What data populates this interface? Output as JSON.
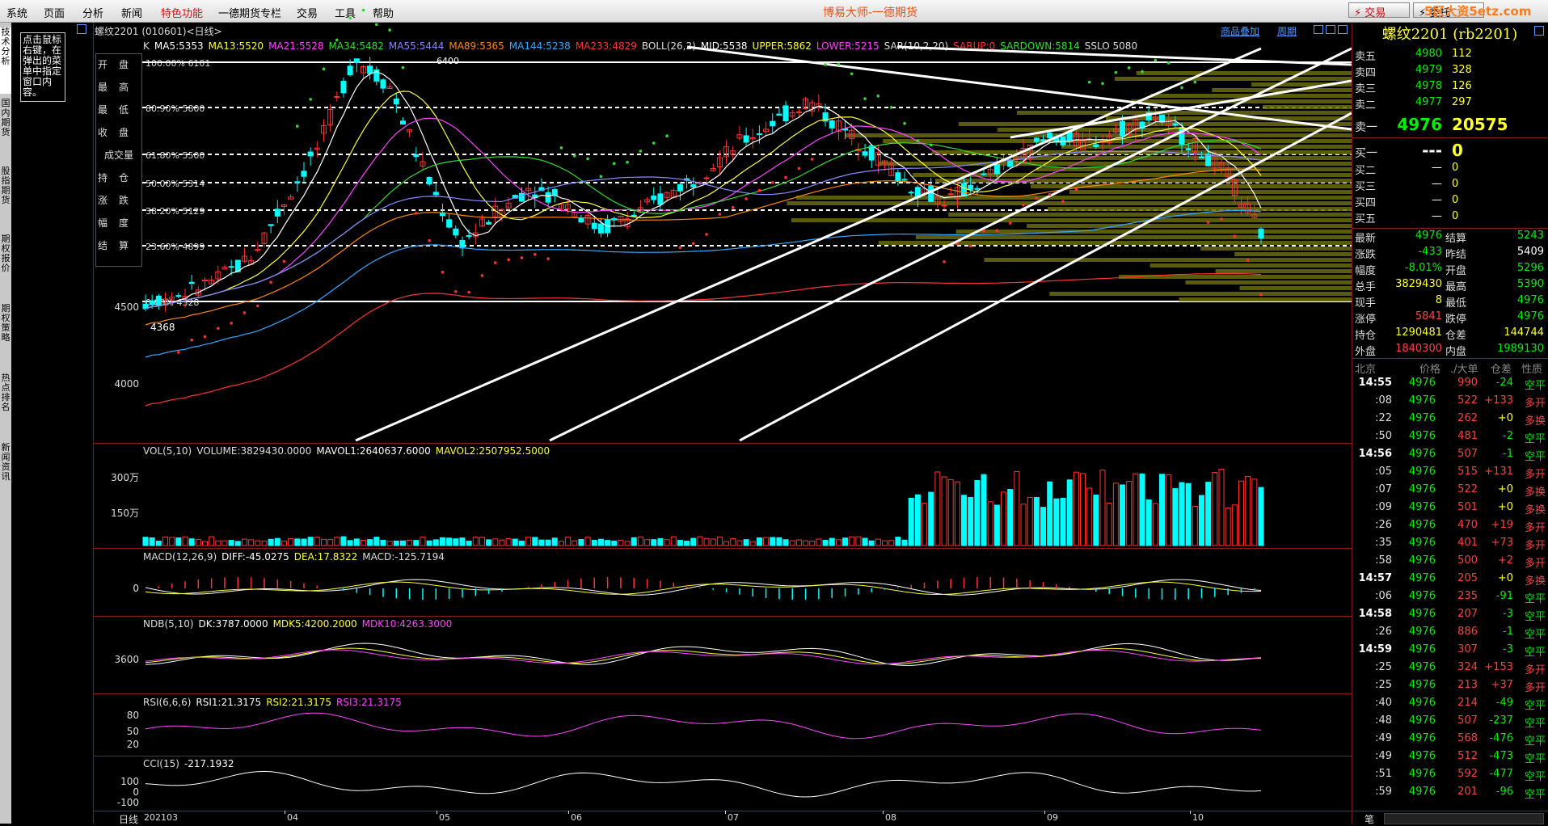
{
  "menu": [
    "系统",
    "页面",
    "分析",
    "新闻",
    "特色功能",
    "一德期货专栏",
    "交易",
    "工具",
    "帮助"
  ],
  "app_title": "博易大师-一德期货",
  "toolbar": {
    "trade_label": "⚡ 交易",
    "second_label": "⚡ 委托",
    "watermark": "5区大资5etz.com"
  },
  "sidebar_tabs": [
    "技术分析",
    "国内期货",
    "股指期货",
    "期权报价",
    "期权策略",
    "热点排名",
    "新闻资讯"
  ],
  "tip_text": "点击鼠标右键，在弹出的菜单中指定窗口内容。",
  "chart_header": {
    "symbol_line": "螺纹2201 (010601)<日线>",
    "overlay_btn": "商品叠加",
    "period_btn": "周期",
    "ma_line": [
      {
        "t": "K",
        "c": "#dddddd"
      },
      {
        "t": "MA5:5353",
        "c": "#ffffff"
      },
      {
        "t": "MA13:5520",
        "c": "#ffff33"
      },
      {
        "t": "MA21:5528",
        "c": "#ff44ff"
      },
      {
        "t": "MA34:5482",
        "c": "#33dd33"
      },
      {
        "t": "MA55:5444",
        "c": "#8888ff"
      },
      {
        "t": "MA89:5365",
        "c": "#ff8800"
      },
      {
        "t": "MA144:5238",
        "c": "#33aaff"
      },
      {
        "t": "MA233:4829",
        "c": "#ff3333"
      },
      {
        "t": "BOLL(26,2)",
        "c": "#dddddd"
      },
      {
        "t": "MID:5538",
        "c": "#ffffff"
      },
      {
        "t": "UPPER:5862",
        "c": "#ffff33"
      },
      {
        "t": "LOWER:5215",
        "c": "#ff44ff"
      },
      {
        "t": "SAR(10,2,20)",
        "c": "#dddddd"
      },
      {
        "t": "SARUP:0",
        "c": "#ff3333"
      },
      {
        "t": "SARDOWN:5814",
        "c": "#33dd33"
      },
      {
        "t": "SSLO 5080",
        "c": "#dddddd"
      }
    ]
  },
  "ohlc_labels": [
    "开盘",
    "最高",
    "最低",
    "收盘",
    "成交量",
    "持仓",
    "涨跌",
    "幅度",
    "结算"
  ],
  "fib_levels": [
    {
      "label": "100.00% 6101",
      "value": 6101
    },
    {
      "label": "80.90% 5800",
      "value": 5800
    },
    {
      "label": "61.80% 5500",
      "value": 5500
    },
    {
      "label": "50.00% 5314",
      "value": 5314
    },
    {
      "label": "38.20% 5129",
      "value": 5129
    },
    {
      "label": "23.60% 4899",
      "value": 4899
    },
    {
      "label": "0.00% 4328",
      "value": 4328
    }
  ],
  "price_annotations": {
    "high": "6400",
    "low": "4368"
  },
  "price_ticks": [
    "4500",
    "4000"
  ],
  "volume_panel": {
    "header": [
      {
        "t": "VOL(5,10)",
        "c": "#dddddd"
      },
      {
        "t": "VOLUME:3829430.0000",
        "c": "#dddddd"
      },
      {
        "t": "MAVOL1:2640637.6000",
        "c": "#ffffff"
      },
      {
        "t": "MAVOL2:2507952.5000",
        "c": "#ffff33"
      }
    ],
    "ticks": [
      "300万",
      "150万"
    ]
  },
  "macd_panel": {
    "header": [
      {
        "t": "MACD(12,26,9)",
        "c": "#dddddd"
      },
      {
        "t": "DIFF:-45.0275",
        "c": "#ffffff"
      },
      {
        "t": "DEA:17.8322",
        "c": "#ffff33"
      },
      {
        "t": "MACD:-125.7194",
        "c": "#dddddd"
      }
    ],
    "ticks": [
      "0"
    ]
  },
  "ndb_panel": {
    "header": [
      {
        "t": "NDB(5,10)",
        "c": "#dddddd"
      },
      {
        "t": "DK:3787.0000",
        "c": "#ffffff"
      },
      {
        "t": "MDK5:4200.2000",
        "c": "#ffff33"
      },
      {
        "t": "MDK10:4263.3000",
        "c": "#ff44ff"
      }
    ],
    "ticks": [
      "3600"
    ]
  },
  "rsi_panel": {
    "header": [
      {
        "t": "RSI(6,6,6)",
        "c": "#dddddd"
      },
      {
        "t": "RSI1:21.3175",
        "c": "#ffffff"
      },
      {
        "t": "RSI2:21.3175",
        "c": "#ffff33"
      },
      {
        "t": "RSI3:21.3175",
        "c": "#ff44ff"
      }
    ],
    "ticks": [
      "80",
      "50",
      "20"
    ]
  },
  "cci_panel": {
    "header": [
      {
        "t": "CCI(15)",
        "c": "#dddddd"
      },
      {
        "t": "-217.1932",
        "c": "#ffffff"
      }
    ],
    "ticks": [
      "100",
      "0",
      "-100"
    ]
  },
  "x_axis": {
    "period": "日线",
    "labels": [
      "202103",
      "04",
      "05",
      "06",
      "07",
      "08",
      "09",
      "10"
    ]
  },
  "right_panel": {
    "title": "螺纹2201 (rb2201)",
    "asks": [
      {
        "label": "卖五",
        "price": "4980",
        "vol": "112"
      },
      {
        "label": "卖四",
        "price": "4979",
        "vol": "328"
      },
      {
        "label": "卖三",
        "price": "4978",
        "vol": "126"
      },
      {
        "label": "卖二",
        "price": "4977",
        "vol": "297"
      },
      {
        "label": "卖一",
        "price": "4976",
        "vol": "20575"
      }
    ],
    "bids": [
      {
        "label": "买一",
        "price": "---",
        "vol": "0"
      },
      {
        "label": "买二",
        "price": "—",
        "vol": "0"
      },
      {
        "label": "买三",
        "price": "—",
        "vol": "0"
      },
      {
        "label": "买四",
        "price": "—",
        "vol": "0"
      },
      {
        "label": "买五",
        "price": "—",
        "vol": "0"
      }
    ],
    "stats": [
      {
        "l1": "最新",
        "v1": "4976",
        "c1": "green",
        "l2": "结算",
        "v2": "5243",
        "c2": "green"
      },
      {
        "l1": "涨跌",
        "v1": "-433",
        "c1": "green",
        "l2": "昨结",
        "v2": "5409",
        "c2": "white"
      },
      {
        "l1": "幅度",
        "v1": "-8.01%",
        "c1": "green",
        "l2": "开盘",
        "v2": "5296",
        "c2": "green"
      },
      {
        "l1": "总手",
        "v1": "3829430",
        "c1": "yellow",
        "l2": "最高",
        "v2": "5390",
        "c2": "green"
      },
      {
        "l1": "现手",
        "v1": "8",
        "c1": "yellow",
        "l2": "最低",
        "v2": "4976",
        "c2": "green"
      },
      {
        "l1": "涨停",
        "v1": "5841",
        "c1": "red",
        "l2": "跌停",
        "v2": "4976",
        "c2": "green"
      },
      {
        "l1": "持仓",
        "v1": "1290481",
        "c1": "yellow",
        "l2": "仓差",
        "v2": "144744",
        "c2": "yellow"
      },
      {
        "l1": "外盘",
        "v1": "1840300",
        "c1": "red",
        "l2": "内盘",
        "v2": "1989130",
        "c2": "green"
      }
    ],
    "ticks_header": {
      "loc": "北京",
      "price": "价格",
      "big": "./大单",
      "oi": "仓差",
      "nature": "性质"
    },
    "ticks": [
      {
        "time": "14:55",
        "price": "4976",
        "vol": "990",
        "oi": "-24",
        "nat": "空平",
        "oc": "green",
        "nc": "green"
      },
      {
        "time": ":08",
        "price": "4976",
        "vol": "522",
        "oi": "+133",
        "nat": "多开",
        "oc": "red",
        "nc": "red"
      },
      {
        "time": ":22",
        "price": "4976",
        "vol": "262",
        "oi": "+0",
        "nat": "多换",
        "oc": "yellow",
        "nc": "red"
      },
      {
        "time": ":50",
        "price": "4976",
        "vol": "481",
        "oi": "-2",
        "nat": "空平",
        "oc": "green",
        "nc": "green"
      },
      {
        "time": "14:56",
        "price": "4976",
        "vol": "507",
        "oi": "-1",
        "nat": "空平",
        "oc": "green",
        "nc": "green"
      },
      {
        "time": ":05",
        "price": "4976",
        "vol": "515",
        "oi": "+131",
        "nat": "多开",
        "oc": "red",
        "nc": "red"
      },
      {
        "time": ":07",
        "price": "4976",
        "vol": "522",
        "oi": "+0",
        "nat": "多换",
        "oc": "yellow",
        "nc": "red"
      },
      {
        "time": ":09",
        "price": "4976",
        "vol": "501",
        "oi": "+0",
        "nat": "多换",
        "oc": "yellow",
        "nc": "red"
      },
      {
        "time": ":26",
        "price": "4976",
        "vol": "470",
        "oi": "+19",
        "nat": "多开",
        "oc": "red",
        "nc": "red"
      },
      {
        "time": ":35",
        "price": "4976",
        "vol": "401",
        "oi": "+73",
        "nat": "多开",
        "oc": "red",
        "nc": "red"
      },
      {
        "time": ":58",
        "price": "4976",
        "vol": "500",
        "oi": "+2",
        "nat": "多开",
        "oc": "red",
        "nc": "red"
      },
      {
        "time": "14:57",
        "price": "4976",
        "vol": "205",
        "oi": "+0",
        "nat": "多换",
        "oc": "yellow",
        "nc": "red"
      },
      {
        "time": ":06",
        "price": "4976",
        "vol": "235",
        "oi": "-91",
        "nat": "空平",
        "oc": "green",
        "nc": "green"
      },
      {
        "time": "14:58",
        "price": "4976",
        "vol": "207",
        "oi": "-3",
        "nat": "空平",
        "oc": "green",
        "nc": "green"
      },
      {
        "time": ":26",
        "price": "4976",
        "vol": "886",
        "oi": "-1",
        "nat": "空平",
        "oc": "green",
        "nc": "green"
      },
      {
        "time": "14:59",
        "price": "4976",
        "vol": "307",
        "oi": "-3",
        "nat": "空平",
        "oc": "green",
        "nc": "green"
      },
      {
        "time": ":25",
        "price": "4976",
        "vol": "324",
        "oi": "+153",
        "nat": "多开",
        "oc": "red",
        "nc": "red"
      },
      {
        "time": ":25",
        "price": "4976",
        "vol": "213",
        "oi": "+37",
        "nat": "多开",
        "oc": "red",
        "nc": "red"
      },
      {
        "time": ":40",
        "price": "4976",
        "vol": "214",
        "oi": "-49",
        "nat": "空平",
        "oc": "green",
        "nc": "green"
      },
      {
        "time": ":48",
        "price": "4976",
        "vol": "507",
        "oi": "-237",
        "nat": "空平",
        "oc": "green",
        "nc": "green"
      },
      {
        "time": ":49",
        "price": "4976",
        "vol": "568",
        "oi": "-476",
        "nat": "空平",
        "oc": "green",
        "nc": "green"
      },
      {
        "time": ":49",
        "price": "4976",
        "vol": "512",
        "oi": "-473",
        "nat": "空平",
        "oc": "green",
        "nc": "green"
      },
      {
        "time": ":51",
        "price": "4976",
        "vol": "592",
        "oi": "-477",
        "nat": "空平",
        "oc": "green",
        "nc": "green"
      },
      {
        "time": ":59",
        "price": "4976",
        "vol": "201",
        "oi": "-96",
        "nat": "空平",
        "oc": "green",
        "nc": "green"
      }
    ],
    "footer_label": "笔"
  }
}
